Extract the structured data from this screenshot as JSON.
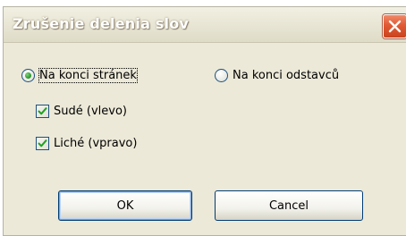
{
  "dialog": {
    "title": "Zrušenie delenia slov",
    "options": {
      "radio_page_end": {
        "label": "Na konci stránek",
        "checked": true
      },
      "radio_paragraph_end": {
        "label": "Na konci odstavců",
        "checked": false
      },
      "check_even": {
        "label": "Sudé (vlevo)",
        "checked": true
      },
      "check_odd": {
        "label": "Liché (vpravo)",
        "checked": true
      }
    },
    "buttons": {
      "ok": "OK",
      "cancel": "Cancel"
    }
  },
  "colors": {
    "window_bg": "#ece9d8",
    "close_red": "#e05a34",
    "border_blue": "#1c5180",
    "radio_green": "#2f9a2f"
  },
  "icons": {
    "close": "close-icon",
    "check": "checkmark-icon"
  }
}
